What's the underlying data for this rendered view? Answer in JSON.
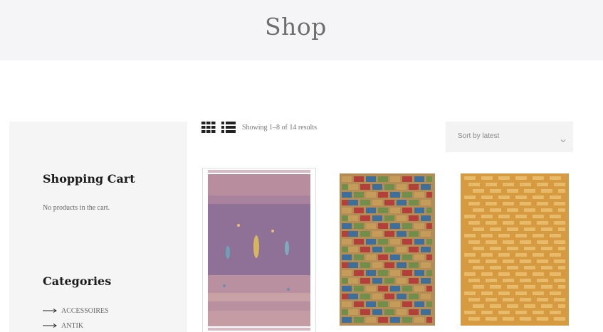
{
  "page": {
    "title": "Shop"
  },
  "sidebar": {
    "cart": {
      "title": "Shopping Cart",
      "empty_text": "No products in the cart."
    },
    "categories": {
      "title": "Categories",
      "items": [
        {
          "label": "ACCESSOIRES"
        },
        {
          "label": "ANTIK"
        }
      ]
    }
  },
  "toolbar": {
    "grid_view_icon": "grid-view-icon",
    "list_view_icon": "list-view-icon",
    "result_count": "Showing 1–8 of 14 results",
    "sort": {
      "selected": "Sort by latest"
    }
  },
  "products": [
    {
      "image": "purple-gabbeh-rug",
      "colors": [
        "#8a6a95",
        "#b98fa3",
        "#c9a3a8"
      ]
    },
    {
      "image": "multicolor-brick-pattern-rug",
      "colors": [
        "#c59c5a",
        "#b33e3a",
        "#3e6f9a",
        "#6f8f4a"
      ]
    },
    {
      "image": "golden-striped-rug",
      "colors": [
        "#d9a24a",
        "#e7bb6a"
      ]
    }
  ],
  "colors": {
    "header_bg": "#f5f5f7",
    "sidebar_bg": "#f5f5f5",
    "title_text": "#6e6e6e",
    "heading_text": "#1c1c1c"
  }
}
